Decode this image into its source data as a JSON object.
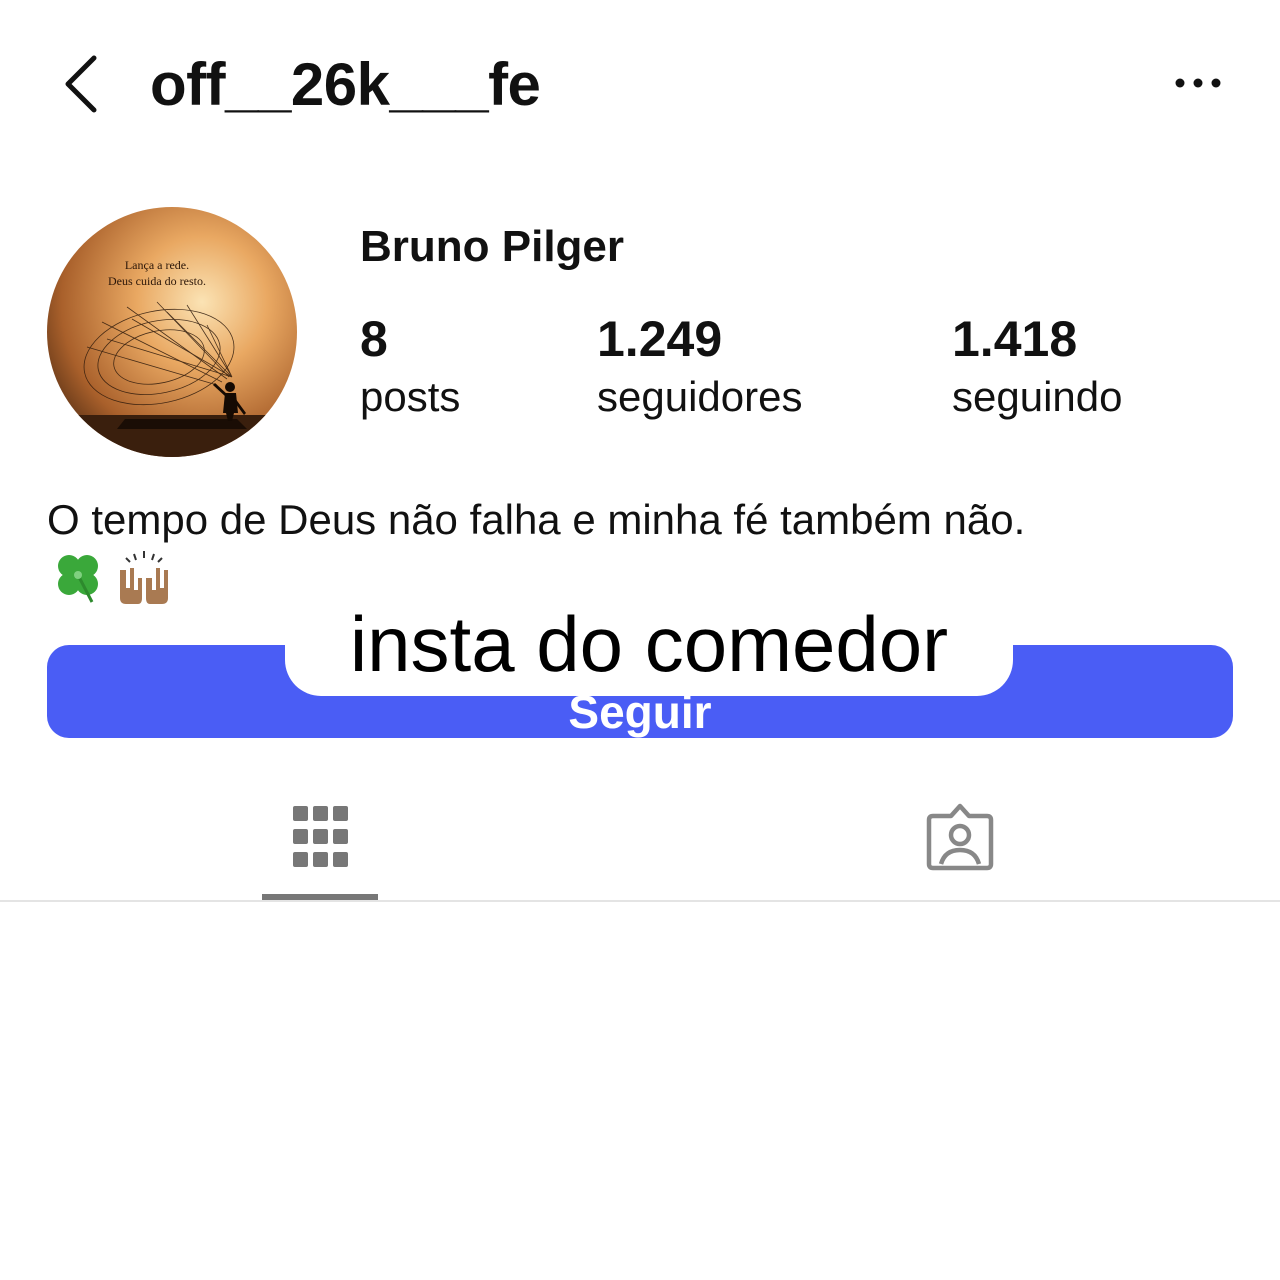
{
  "header": {
    "username": "off__26k___fe",
    "back_icon": "chevron-left-icon",
    "more_icon": "more-horizontal-icon"
  },
  "profile": {
    "display_name": "Bruno Pilger",
    "avatar": {
      "line1": "Lança a rede.",
      "line2": "Deus cuida do resto."
    },
    "stats": {
      "posts": {
        "value": "8",
        "label": "posts"
      },
      "followers": {
        "value": "1.249",
        "label": "seguidores"
      },
      "following": {
        "value": "1.418",
        "label": "seguindo"
      }
    },
    "bio": "O tempo de Deus não falha e minha fé também não.",
    "bio_emojis": [
      "four-leaf-clover",
      "raising-hands"
    ]
  },
  "follow_button": {
    "label": "Seguir",
    "color": "#4a5df5"
  },
  "overlay_caption": "insta do comedor",
  "tabs": [
    {
      "name": "posts-grid",
      "icon": "grid-icon",
      "active": true
    },
    {
      "name": "tagged",
      "icon": "tagged-person-icon",
      "active": false
    }
  ]
}
